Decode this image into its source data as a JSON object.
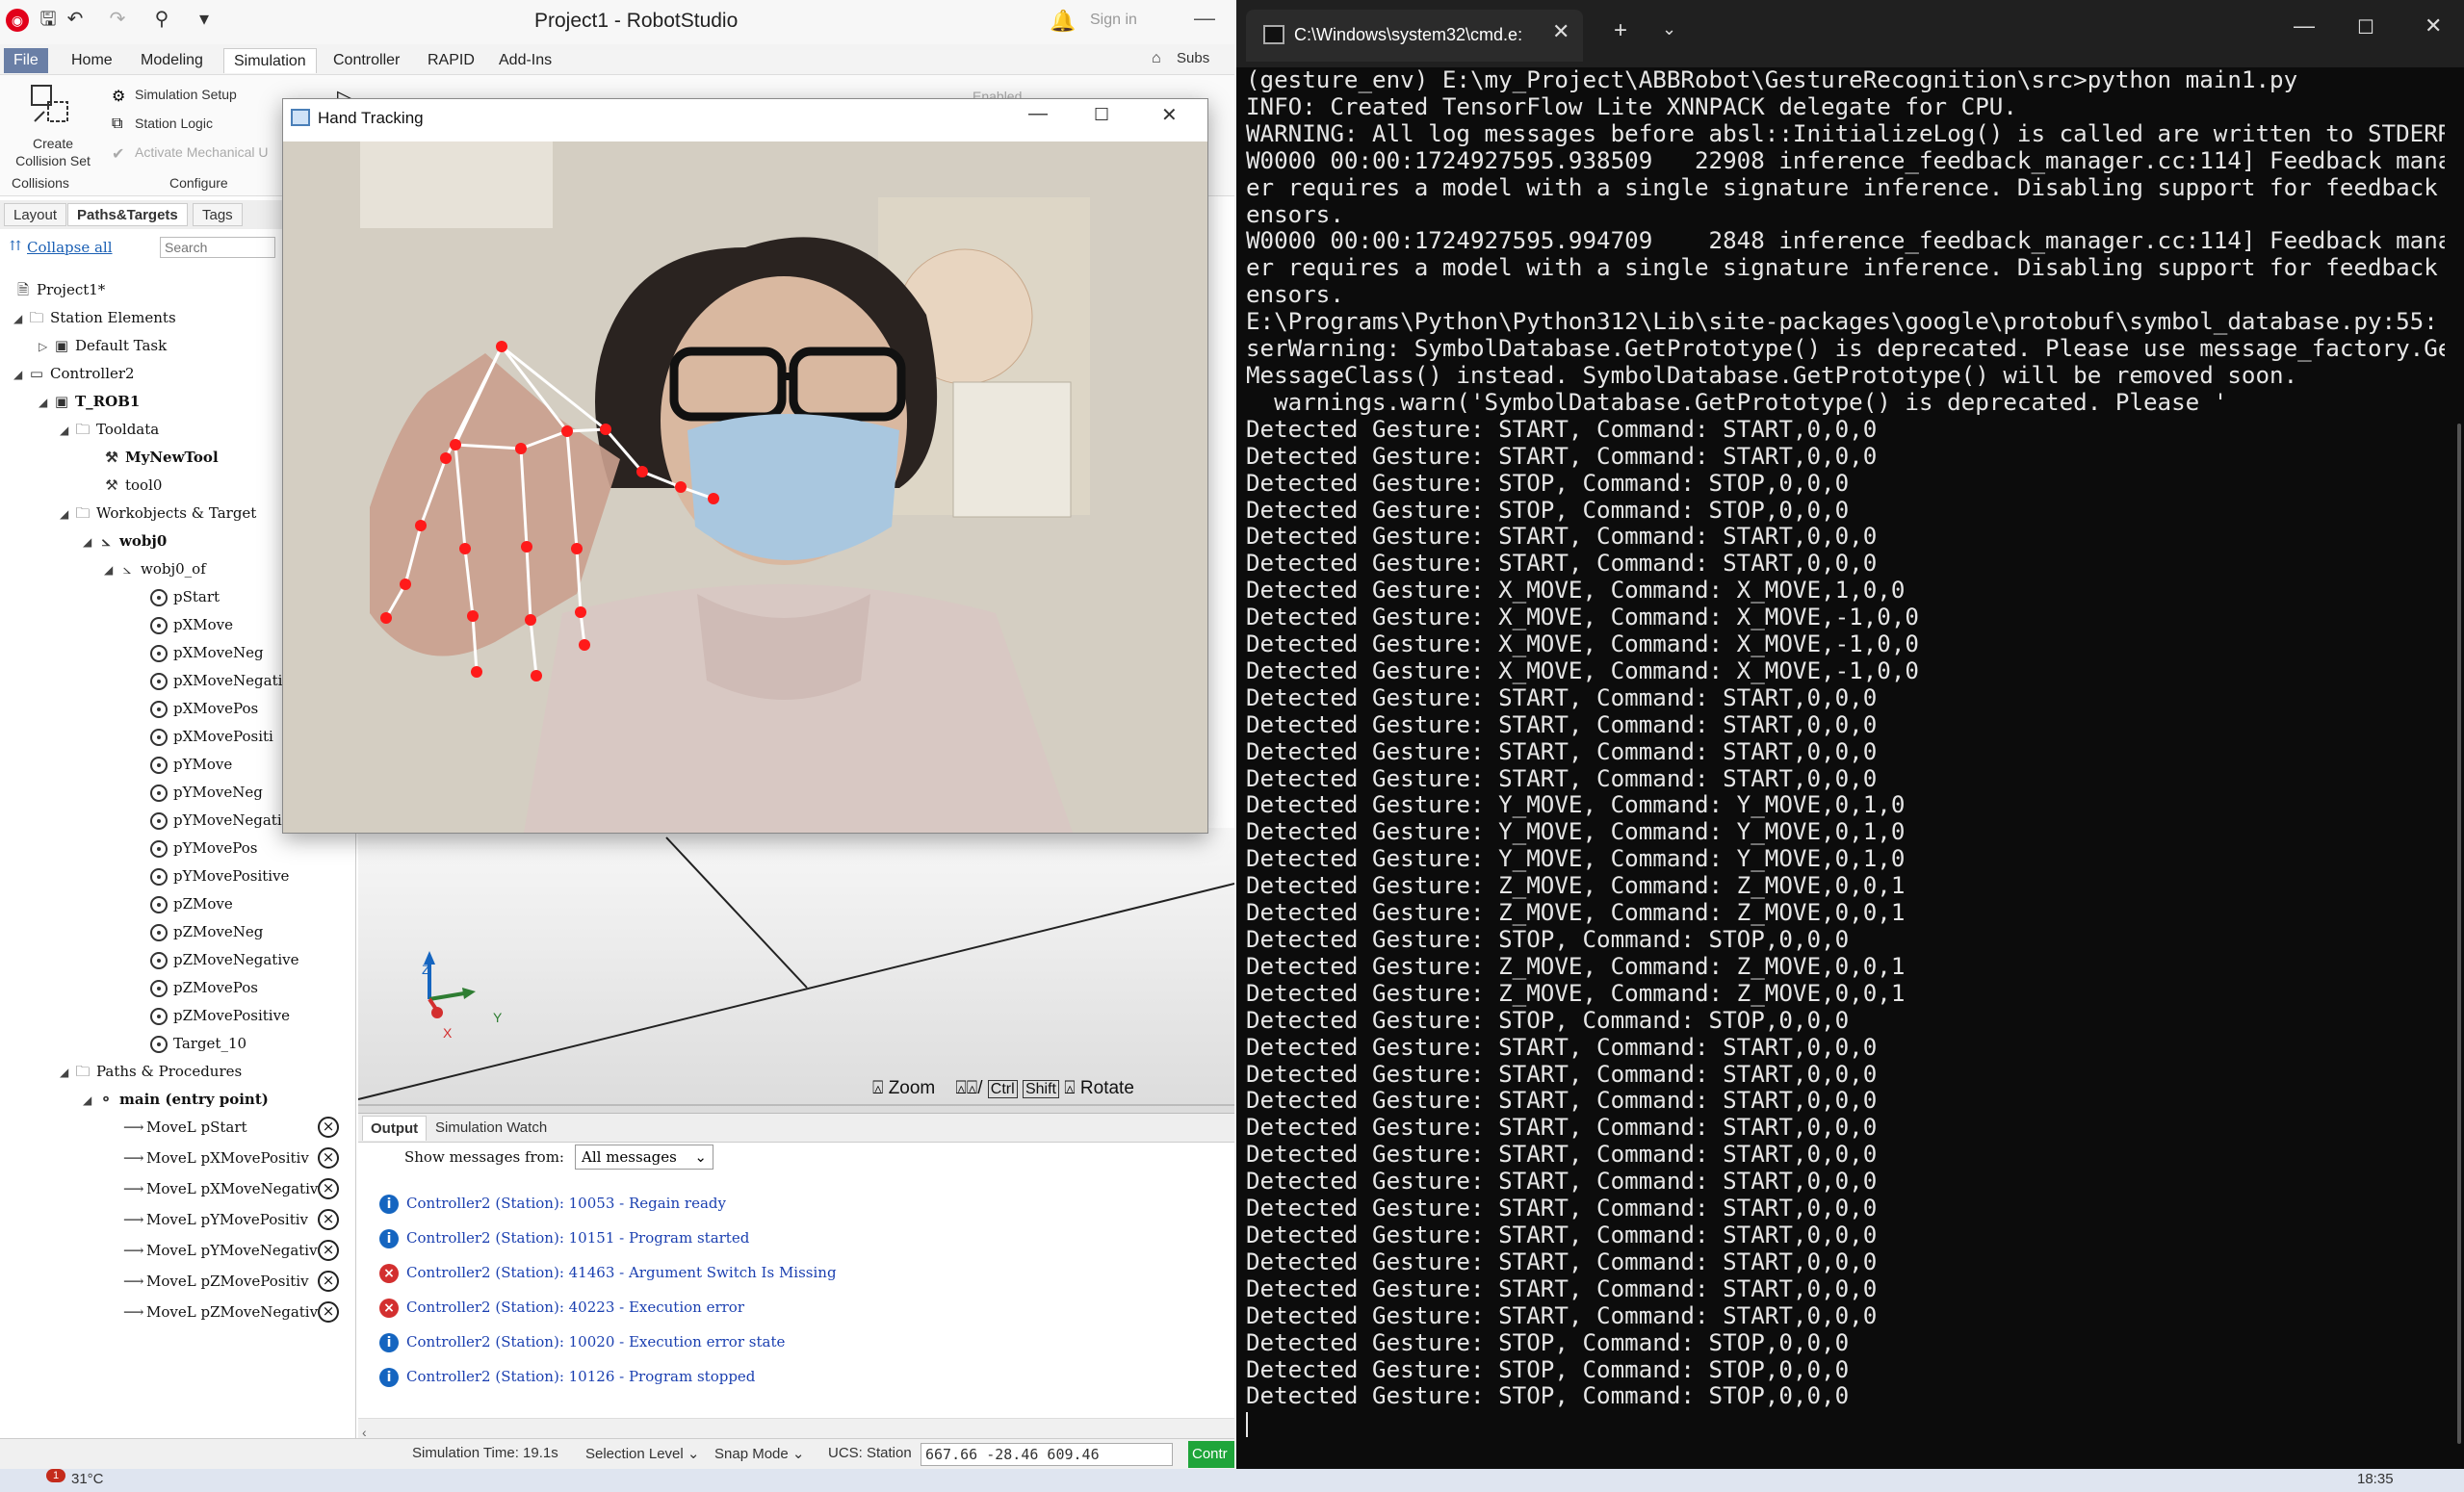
{
  "robotstudio": {
    "title": "Project1 - RobotStudio",
    "sign_in": "Sign in",
    "menu_tabs": [
      "File",
      "Home",
      "Modeling",
      "Simulation",
      "Controller",
      "RAPID",
      "Add-Ins"
    ],
    "ribbon": {
      "create_collision_set": "Create\nCollision Set",
      "collisions_group": "Collisions",
      "simulation_setup": "Simulation Setup",
      "station_logic": "Station Logic",
      "activate_mechanical": "Activate Mechanical U",
      "configure_group": "Configure",
      "enabled": "Enabled",
      "subs": "Subs"
    },
    "side_tabs": [
      "Layout",
      "Paths&Targets",
      "Tags"
    ],
    "collapse_all": "Collapse all",
    "search_placeholder": "Search",
    "tree": {
      "project": "Project1*",
      "station_elements": "Station Elements",
      "default_task": "Default Task",
      "controller": "Controller2",
      "task": "T_ROB1",
      "tooldata": "Tooldata",
      "mynewtool": "MyNewTool",
      "tool0": "tool0",
      "workobjects": "Workobjects & Target",
      "wobj0": "wobj0",
      "wobj0_of": "wobj0_of",
      "targets": [
        "pStart",
        "pXMove",
        "pXMoveNeg",
        "pXMoveNegati",
        "pXMovePos",
        "pXMovePositi",
        "pYMove",
        "pYMoveNeg",
        "pYMoveNegati",
        "pYMovePos",
        "pYMovePositive",
        "pZMove",
        "pZMoveNeg",
        "pZMoveNegative",
        "pZMovePos",
        "pZMovePositive",
        "Target_10"
      ],
      "paths": "Paths & Procedures",
      "main": "main (entry point)",
      "moves": [
        "MoveL pStart",
        "MoveL pXMovePositiv",
        "MoveL pXMoveNegativ",
        "MoveL pYMovePositiv",
        "MoveL pYMoveNegativ",
        "MoveL pZMovePositiv",
        "MoveL pZMoveNegativ"
      ]
    },
    "view_toolbar": {
      "zoom": "Zoom",
      "ctrl": "Ctrl",
      "shift": "Shift",
      "rotate": "Rotate"
    },
    "axes": {
      "x": "X",
      "y": "Y",
      "z": "Z"
    },
    "output": {
      "tabs": [
        "Output",
        "Simulation Watch"
      ],
      "filter_label": "Show messages from:",
      "filter_value": "All messages",
      "messages": [
        {
          "type": "info",
          "text": "Controller2 (Station): 10053 - Regain ready"
        },
        {
          "type": "info",
          "text": "Controller2 (Station): 10151 - Program started"
        },
        {
          "type": "error",
          "text": "Controller2 (Station): 41463 - Argument Switch Is Missing"
        },
        {
          "type": "error",
          "text": "Controller2 (Station): 40223 - Execution error"
        },
        {
          "type": "info",
          "text": "Controller2 (Station): 10020 - Execution error state"
        },
        {
          "type": "info",
          "text": "Controller2 (Station): 10126 - Program stopped"
        }
      ]
    },
    "status": {
      "sim_time": "Simulation Time: 19.1s",
      "selection_level": "Selection Level",
      "snap_mode": "Snap Mode",
      "ucs_label": "UCS: Station",
      "ucs_value": "667.66   -28.46   609.46",
      "contr": "Contr"
    }
  },
  "hand_tracking": {
    "title": "Hand Tracking"
  },
  "terminal": {
    "tab_title": "C:\\Windows\\system32\\cmd.e:",
    "lines": [
      "(gesture_env) E:\\my_Project\\ABBRobot\\GestureRecognition\\src>python main1.py",
      "INFO: Created TensorFlow Lite XNNPACK delegate for CPU.",
      "WARNING: All log messages before absl::InitializeLog() is called are written to STDERR",
      "W0000 00:00:1724927595.938509   22908 inference_feedback_manager.cc:114] Feedback manag",
      "er requires a model with a single signature inference. Disabling support for feedback t",
      "ensors.",
      "W0000 00:00:1724927595.994709    2848 inference_feedback_manager.cc:114] Feedback manag",
      "er requires a model with a single signature inference. Disabling support for feedback t",
      "ensors.",
      "E:\\Programs\\Python\\Python312\\Lib\\site-packages\\google\\protobuf\\symbol_database.py:55: U",
      "serWarning: SymbolDatabase.GetPrototype() is deprecated. Please use message_factory.Get",
      "MessageClass() instead. SymbolDatabase.GetPrototype() will be removed soon.",
      "  warnings.warn('SymbolDatabase.GetPrototype() is deprecated. Please '",
      "Detected Gesture: START, Command: START,0,0,0",
      "Detected Gesture: START, Command: START,0,0,0",
      "Detected Gesture: STOP, Command: STOP,0,0,0",
      "Detected Gesture: STOP, Command: STOP,0,0,0",
      "Detected Gesture: START, Command: START,0,0,0",
      "Detected Gesture: START, Command: START,0,0,0",
      "Detected Gesture: X_MOVE, Command: X_MOVE,1,0,0",
      "Detected Gesture: X_MOVE, Command: X_MOVE,-1,0,0",
      "Detected Gesture: X_MOVE, Command: X_MOVE,-1,0,0",
      "Detected Gesture: X_MOVE, Command: X_MOVE,-1,0,0",
      "Detected Gesture: START, Command: START,0,0,0",
      "Detected Gesture: START, Command: START,0,0,0",
      "Detected Gesture: START, Command: START,0,0,0",
      "Detected Gesture: START, Command: START,0,0,0",
      "Detected Gesture: Y_MOVE, Command: Y_MOVE,0,1,0",
      "Detected Gesture: Y_MOVE, Command: Y_MOVE,0,1,0",
      "Detected Gesture: Y_MOVE, Command: Y_MOVE,0,1,0",
      "Detected Gesture: Z_MOVE, Command: Z_MOVE,0,0,1",
      "Detected Gesture: Z_MOVE, Command: Z_MOVE,0,0,1",
      "Detected Gesture: STOP, Command: STOP,0,0,0",
      "Detected Gesture: Z_MOVE, Command: Z_MOVE,0,0,1",
      "Detected Gesture: Z_MOVE, Command: Z_MOVE,0,0,1",
      "Detected Gesture: STOP, Command: STOP,0,0,0",
      "Detected Gesture: START, Command: START,0,0,0",
      "Detected Gesture: START, Command: START,0,0,0",
      "Detected Gesture: START, Command: START,0,0,0",
      "Detected Gesture: START, Command: START,0,0,0",
      "Detected Gesture: START, Command: START,0,0,0",
      "Detected Gesture: START, Command: START,0,0,0",
      "Detected Gesture: START, Command: START,0,0,0",
      "Detected Gesture: START, Command: START,0,0,0",
      "Detected Gesture: START, Command: START,0,0,0",
      "Detected Gesture: START, Command: START,0,0,0",
      "Detected Gesture: START, Command: START,0,0,0",
      "Detected Gesture: STOP, Command: STOP,0,0,0",
      "Detected Gesture: STOP, Command: STOP,0,0,0",
      "Detected Gesture: STOP, Command: STOP,0,0,0"
    ]
  },
  "taskbar": {
    "weather": "31°C",
    "badge": "1",
    "time": "18:35"
  },
  "colors": {
    "landmark": "#ff1a1a",
    "connection": "#ffffff",
    "terminal_bg": "#0c0c0c",
    "info": "#1565c0",
    "error": "#d32f2f"
  }
}
